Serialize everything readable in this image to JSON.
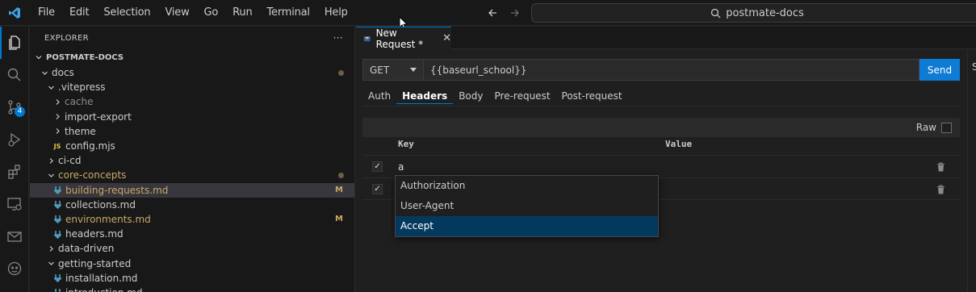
{
  "colors": {
    "accent": "#0078d4",
    "logo": "#3ca3e8",
    "folder_modified": "#c9a867",
    "md_icon": "#519aba",
    "js_icon": "#e2c54c"
  },
  "menu": [
    "File",
    "Edit",
    "Selection",
    "View",
    "Go",
    "Run",
    "Terminal",
    "Help"
  ],
  "command_center": {
    "label": "postmate-docs",
    "icon": "search-icon"
  },
  "activity": {
    "scm_badge": "4"
  },
  "explorer": {
    "title": "EXPLORER",
    "more": "···",
    "root": "POSTMATE-DOCS",
    "tree": [
      {
        "label": "docs",
        "depth": 0,
        "kind": "folder",
        "open": true,
        "status": "dot"
      },
      {
        "label": ".vitepress",
        "depth": 1,
        "kind": "folder",
        "open": true,
        "status": ""
      },
      {
        "label": "cache",
        "depth": 2,
        "kind": "folder",
        "open": false,
        "status": "",
        "dim": true
      },
      {
        "label": "import-export",
        "depth": 2,
        "kind": "folder",
        "open": false,
        "status": ""
      },
      {
        "label": "theme",
        "depth": 2,
        "kind": "folder",
        "open": false,
        "status": ""
      },
      {
        "label": "config.mjs",
        "depth": 2,
        "kind": "js",
        "status": ""
      },
      {
        "label": "ci-cd",
        "depth": 1,
        "kind": "folder",
        "open": false,
        "status": ""
      },
      {
        "label": "core-concepts",
        "depth": 1,
        "kind": "folder",
        "open": true,
        "status": "dot",
        "modified": true
      },
      {
        "label": "building-requests.md",
        "depth": 2,
        "kind": "md",
        "status": "M",
        "modified": true,
        "selected": true
      },
      {
        "label": "collections.md",
        "depth": 2,
        "kind": "md",
        "status": ""
      },
      {
        "label": "environments.md",
        "depth": 2,
        "kind": "md",
        "status": "M",
        "modified": true
      },
      {
        "label": "headers.md",
        "depth": 2,
        "kind": "md",
        "status": ""
      },
      {
        "label": "data-driven",
        "depth": 1,
        "kind": "folder",
        "open": false,
        "status": ""
      },
      {
        "label": "getting-started",
        "depth": 1,
        "kind": "folder",
        "open": true,
        "status": ""
      },
      {
        "label": "installation.md",
        "depth": 2,
        "kind": "md",
        "status": ""
      },
      {
        "label": "introduction.md",
        "depth": 2,
        "kind": "md",
        "status": ""
      }
    ]
  },
  "editor": {
    "tab_title": "New Request *",
    "method": "GET",
    "url": "{{baseurl_school}}",
    "send_label": "Send",
    "request_tabs": [
      "Auth",
      "Headers",
      "Body",
      "Pre-request",
      "Post-request"
    ],
    "active_request_tab": "Headers",
    "raw_label": "Raw",
    "columns": {
      "key": "Key",
      "value": "Value"
    },
    "header_rows": [
      {
        "checked": true,
        "key": "a"
      },
      {
        "checked": true,
        "key": ""
      }
    ],
    "autocomplete": [
      "Authorization",
      "User-Agent",
      "Accept"
    ],
    "autocomplete_active": "Accept",
    "right_panel_label": "S"
  }
}
